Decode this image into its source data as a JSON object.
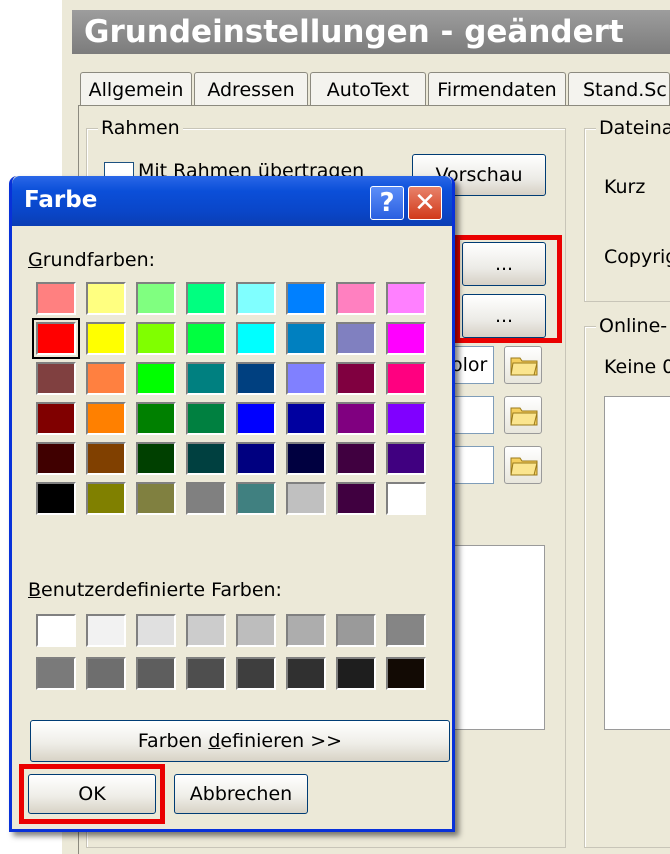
{
  "window": {
    "title": "Grundeinstellungen - geändert",
    "tabs": [
      {
        "label": "Allgemein"
      },
      {
        "label": "Adressen"
      },
      {
        "label": "AutoText"
      },
      {
        "label": "Firmendaten"
      },
      {
        "label": "Stand.Sc"
      }
    ],
    "rahmen_label": "Rahmen",
    "rahmen_checkbox_label": "Mit Rahmen übertragen",
    "vorschau_label": "Vorschau",
    "ellipsis_1": "...",
    "ellipsis_2": "...",
    "field_partial": "olor",
    "dateiname_label": "Dateina",
    "kurz_label": "Kurz",
    "copyright_label": "Copyrig",
    "online_label": "Online-",
    "keine_label": "Keine 0"
  },
  "dialog": {
    "title": "Farbe",
    "help_glyph": "?",
    "close_glyph": "✕",
    "basic_colors_label_u": "G",
    "basic_colors_label_rest": "rundfarben:",
    "basic_colors": [
      "#ff8080",
      "#ffff80",
      "#80ff80",
      "#00ff80",
      "#80ffff",
      "#0080ff",
      "#ff80c0",
      "#ff80ff",
      "#ff0000",
      "#ffff00",
      "#80ff00",
      "#00ff40",
      "#00ffff",
      "#0080c0",
      "#8080c0",
      "#ff00ff",
      "#804040",
      "#ff8040",
      "#00ff00",
      "#008080",
      "#004080",
      "#8080ff",
      "#800040",
      "#ff0080",
      "#800000",
      "#ff8000",
      "#008000",
      "#008040",
      "#0000ff",
      "#0000a0",
      "#800080",
      "#8000ff",
      "#400000",
      "#804000",
      "#004000",
      "#004040",
      "#000080",
      "#000040",
      "#400040",
      "#400080",
      "#000000",
      "#808000",
      "#808040",
      "#808080",
      "#408080",
      "#c0c0c0",
      "#400040",
      "#ffffff"
    ],
    "selected_index": 8,
    "custom_colors_label_u": "B",
    "custom_colors_label_rest": "enutzerdefinierte Farben:",
    "custom_colors": [
      "#ffffff",
      "#f2f2f2",
      "#e0e0e0",
      "#cccccc",
      "#bdbdbd",
      "#adadad",
      "#9a9a9a",
      "#858585",
      "#7a7a7a",
      "#6e6e6e",
      "#5e5e5e",
      "#4e4e4e",
      "#3e3e3e",
      "#303030",
      "#1e1e1e",
      "#120a04"
    ],
    "define_label_pre": "Farben ",
    "define_label_u": "d",
    "define_label_post": "efinieren >>",
    "ok_label": "OK",
    "cancel_label": "Abbrechen"
  },
  "colors": {
    "highlight": "#ea0000",
    "titlebar": "#0b4fd9",
    "face": "#ece9d8"
  }
}
